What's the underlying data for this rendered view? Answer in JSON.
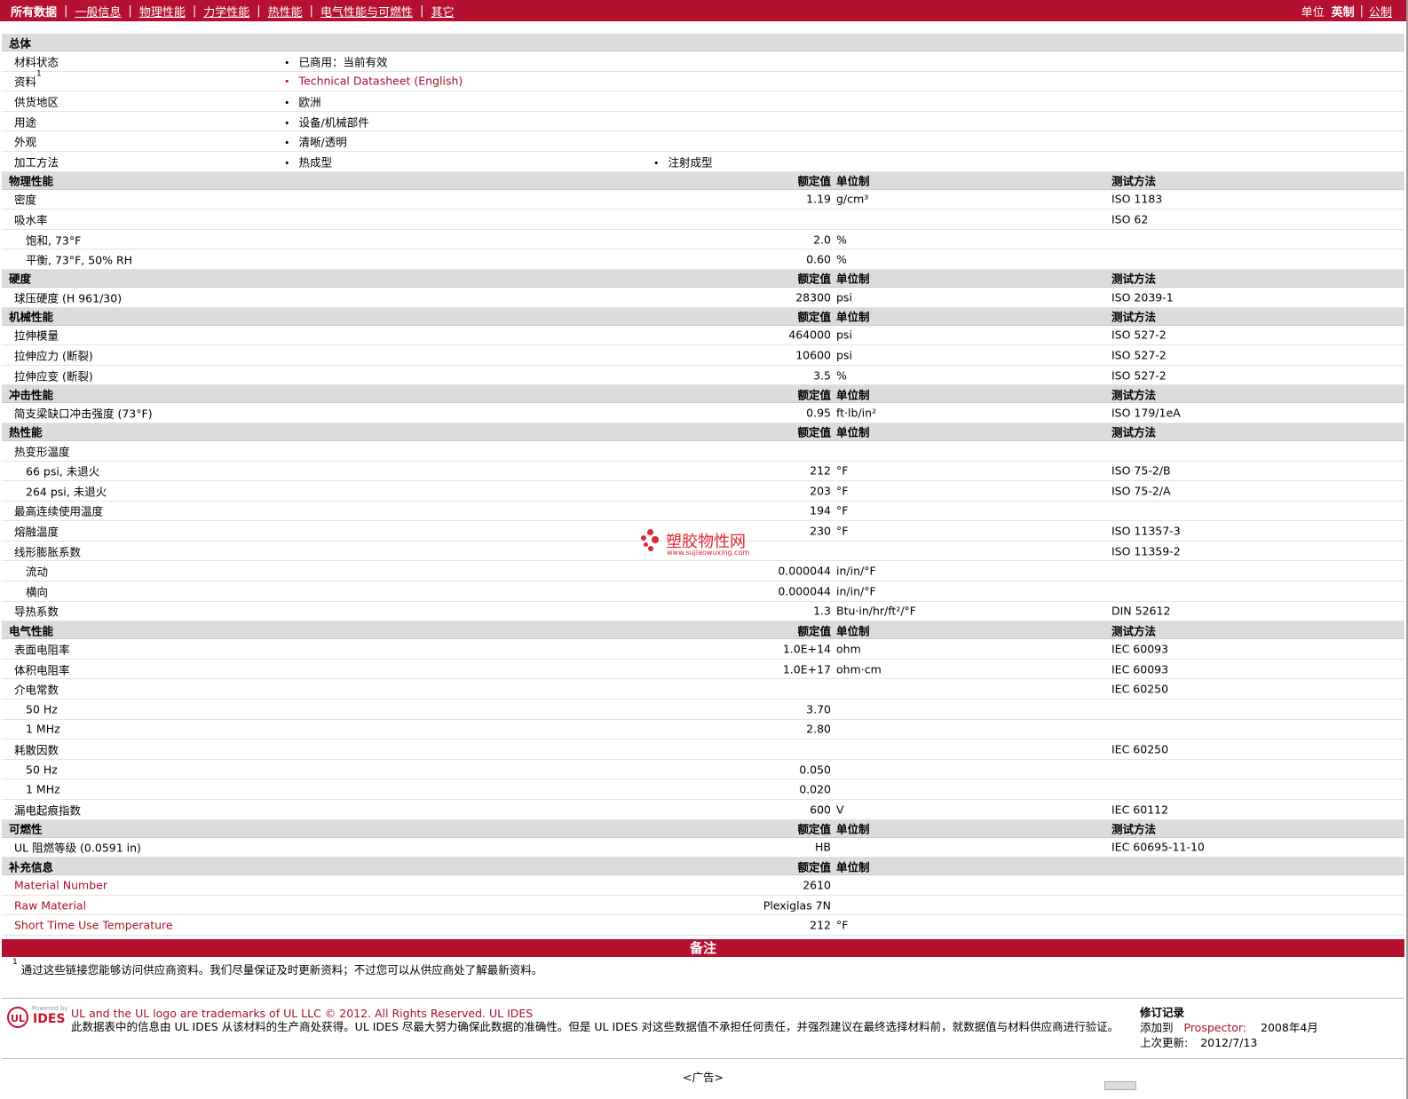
{
  "nav": {
    "items": [
      "所有数据",
      "一般信息",
      "物理性能",
      "力学性能",
      "热性能",
      "电气性能与可燃性",
      "其它"
    ],
    "units_label": "单位",
    "unit_imperial": "英制",
    "unit_metric": "公制"
  },
  "general": {
    "title": "总体",
    "rows": [
      {
        "name": "材料状态",
        "values": [
          "已商用：当前有效"
        ]
      },
      {
        "name": "资料",
        "sup": "1",
        "values": [
          "Technical Datasheet (English)"
        ],
        "link": true
      },
      {
        "name": "供货地区",
        "values": [
          "欧洲"
        ]
      },
      {
        "name": "用途",
        "values": [
          "设备/机械部件"
        ]
      },
      {
        "name": "外观",
        "values": [
          "清晰/透明"
        ]
      },
      {
        "name": "加工方法",
        "values": [
          "热成型",
          "注射成型"
        ]
      }
    ]
  },
  "col_labels": {
    "value": "额定值",
    "unit": "单位制",
    "test": "测试方法"
  },
  "sections": [
    {
      "title": "物理性能",
      "show_test": true,
      "rows": [
        {
          "name": "密度",
          "value": "1.19",
          "unit": "g/cm³",
          "test": "ISO 1183"
        },
        {
          "name": "吸水率",
          "value": "",
          "unit": "",
          "test": "ISO 62"
        },
        {
          "name": "饱和, 73°F",
          "sub": true,
          "value": "2.0",
          "unit": "%",
          "test": ""
        },
        {
          "name": "平衡, 73°F, 50% RH",
          "sub": true,
          "value": "0.60",
          "unit": "%",
          "test": ""
        }
      ]
    },
    {
      "title": "硬度",
      "show_test": true,
      "rows": [
        {
          "name": "球压硬度 (H 961/30)",
          "value": "28300",
          "unit": "psi",
          "test": "ISO 2039-1"
        }
      ]
    },
    {
      "title": "机械性能",
      "show_test": true,
      "rows": [
        {
          "name": "拉伸模量",
          "value": "464000",
          "unit": "psi",
          "test": "ISO 527-2"
        },
        {
          "name": "拉伸应力 (断裂)",
          "value": "10600",
          "unit": "psi",
          "test": "ISO 527-2"
        },
        {
          "name": "拉伸应变 (断裂)",
          "value": "3.5",
          "unit": "%",
          "test": "ISO 527-2"
        }
      ]
    },
    {
      "title": "冲击性能",
      "show_test": true,
      "rows": [
        {
          "name": "简支梁缺口冲击强度 (73°F)",
          "value": "0.95",
          "unit": "ft·lb/in²",
          "test": "ISO 179/1eA"
        }
      ]
    },
    {
      "title": "热性能",
      "show_test": true,
      "rows": [
        {
          "name": "热变形温度",
          "value": "",
          "unit": "",
          "test": ""
        },
        {
          "name": "66 psi, 未退火",
          "sub": true,
          "value": "212",
          "unit": "°F",
          "test": "ISO 75-2/B"
        },
        {
          "name": "264 psi, 未退火",
          "sub": true,
          "value": "203",
          "unit": "°F",
          "test": "ISO 75-2/A"
        },
        {
          "name": "最高连续使用温度",
          "value": "194",
          "unit": "°F",
          "test": ""
        },
        {
          "name": "熔融温度",
          "value": "230",
          "unit": "°F",
          "test": "ISO 11357-3"
        },
        {
          "name": "线形膨胀系数",
          "value": "",
          "unit": "",
          "test": "ISO 11359-2"
        },
        {
          "name": "流动",
          "sub": true,
          "value": "0.000044",
          "unit": "in/in/°F",
          "test": ""
        },
        {
          "name": "横向",
          "sub": true,
          "value": "0.000044",
          "unit": "in/in/°F",
          "test": ""
        },
        {
          "name": "导热系数",
          "value": "1.3",
          "unit": "Btu·in/hr/ft²/°F",
          "test": "DIN 52612"
        }
      ]
    },
    {
      "title": "电气性能",
      "show_test": true,
      "rows": [
        {
          "name": "表面电阻率",
          "value": "1.0E+14",
          "unit": "ohm",
          "test": "IEC 60093"
        },
        {
          "name": "体积电阻率",
          "value": "1.0E+17",
          "unit": "ohm·cm",
          "test": "IEC 60093"
        },
        {
          "name": "介电常数",
          "value": "",
          "unit": "",
          "test": "IEC 60250"
        },
        {
          "name": "50 Hz",
          "sub": true,
          "value": "3.70",
          "unit": "",
          "test": ""
        },
        {
          "name": "1 MHz",
          "sub": true,
          "value": "2.80",
          "unit": "",
          "test": ""
        },
        {
          "name": "耗散因数",
          "value": "",
          "unit": "",
          "test": "IEC 60250"
        },
        {
          "name": "50 Hz",
          "sub": true,
          "value": "0.050",
          "unit": "",
          "test": ""
        },
        {
          "name": "1 MHz",
          "sub": true,
          "value": "0.020",
          "unit": "",
          "test": ""
        },
        {
          "name": "漏电起痕指数",
          "value": "600",
          "unit": "V",
          "test": "IEC 60112"
        }
      ]
    },
    {
      "title": "可燃性",
      "show_test": true,
      "rows": [
        {
          "name": "UL 阻燃等级 (0.0591 in)",
          "value": "HB",
          "unit": "",
          "test": "IEC 60695-11-10"
        }
      ]
    },
    {
      "title": "补充信息",
      "show_test": false,
      "rows": [
        {
          "name": "Material Number",
          "red": true,
          "value": "2610",
          "unit": "",
          "test": ""
        },
        {
          "name": "Raw Material",
          "red": true,
          "value": "Plexiglas 7N",
          "unit": "",
          "test": ""
        },
        {
          "name": "Short Time Use Temperature",
          "red": true,
          "value": "212",
          "unit": "°F",
          "test": ""
        }
      ]
    }
  ],
  "notes": {
    "title": "备注",
    "sup": "1",
    "text": "通过这些链接您能够访问供应商资料。我们尽量保证及时更新资料；不过您可以从供应商处了解最新资料。"
  },
  "footer": {
    "logo_ul": "UL",
    "logo_powered": "Powered by",
    "logo_ides": "IDES",
    "trademark": "UL and the UL logo are trademarks of UL LLC © 2012. All Rights Reserved. UL IDES",
    "disclaimer": "此数据表中的信息由  UL IDES 从该材料的生产商处获得。UL IDES 尽最大努力确保此数据的准确性。但是  UL IDES 对这些数据值不承担任何责任，并强烈建议在最终选择材料前，就数据值与材料供应商进行验证。",
    "revision_title": "修订记录",
    "added_label": "添加到",
    "added_source": "Prospector:",
    "added_date": "2008年4月",
    "updated_label": "上次更新:",
    "updated_date": "2012/7/13"
  },
  "ad_label": "<广告>",
  "watermark": {
    "text": "塑胶物性网",
    "url": "www.sujiaowuxing.com"
  },
  "colors": {
    "brand": "#b5102f",
    "link": "#a8102c",
    "header_bg": "#dcdcdc"
  }
}
